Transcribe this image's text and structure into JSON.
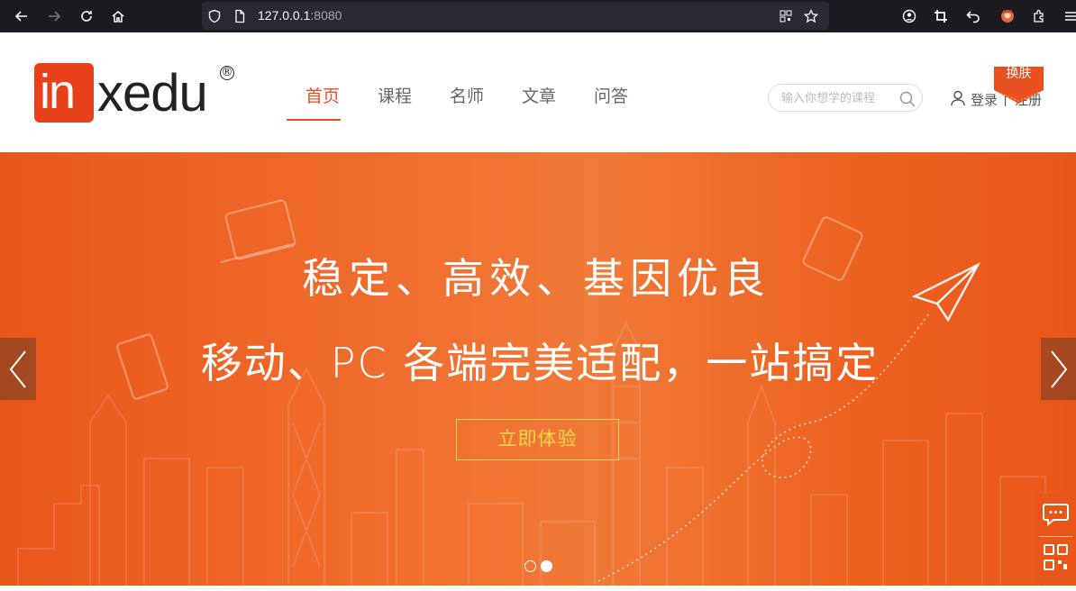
{
  "browser": {
    "url_host": "127.0.0.1",
    "url_port": ":8080"
  },
  "logo": {
    "prefix": "in",
    "suffix": "xedu",
    "mark": "®"
  },
  "nav": {
    "items": [
      {
        "label": "首页",
        "active": true
      },
      {
        "label": "课程",
        "active": false
      },
      {
        "label": "名师",
        "active": false
      },
      {
        "label": "文章",
        "active": false
      },
      {
        "label": "问答",
        "active": false
      }
    ]
  },
  "search": {
    "placeholder": "输入你想学的课程"
  },
  "auth": {
    "login": "登录",
    "separator": "|",
    "register": "注册"
  },
  "skin_button": "换肤",
  "banner": {
    "headline_1": "稳定、高效、基因优良",
    "headline_2": "移动、PC 各端完美适配，一站搞定",
    "cta": "立即体验",
    "slide_count": 2,
    "active_slide": 2
  },
  "colors": {
    "brand": "#e8501f",
    "cta_border": "#f7d64a",
    "browser_bg": "#1c1b22"
  }
}
